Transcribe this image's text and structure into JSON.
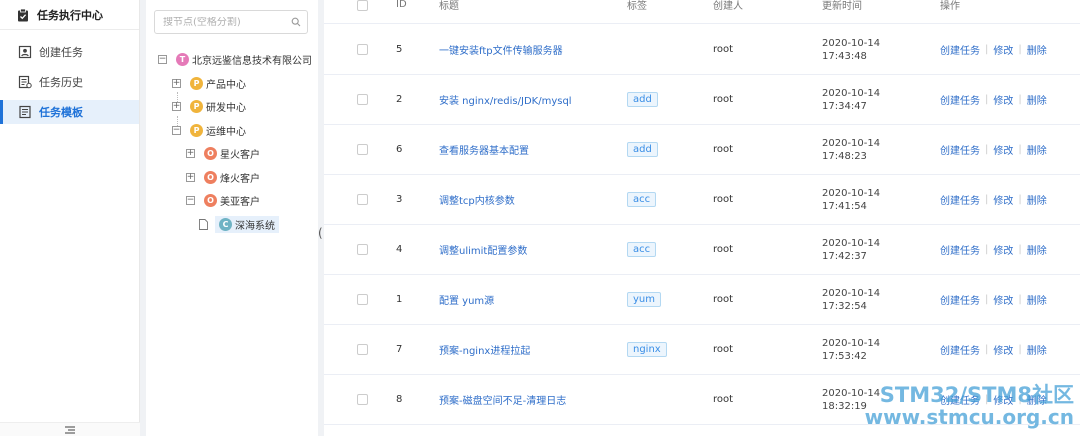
{
  "sidebar": {
    "header": "任务执行中心",
    "items": [
      {
        "label": "创建任务"
      },
      {
        "label": "任务历史"
      },
      {
        "label": "任务模板"
      }
    ]
  },
  "tree": {
    "search_placeholder": "搜节点(空格分割)",
    "root": {
      "badge": "T",
      "label": "北京远鉴信息技术有限公司"
    },
    "level1": [
      {
        "badge": "P",
        "label": "产品中心"
      },
      {
        "badge": "P",
        "label": "研发中心"
      },
      {
        "badge": "P",
        "label": "运维中心"
      }
    ],
    "level2": [
      {
        "badge": "O",
        "label": "星火客户"
      },
      {
        "badge": "O",
        "label": "烽火客户"
      },
      {
        "badge": "O",
        "label": "美亚客户"
      }
    ],
    "level3": {
      "badge": "C",
      "label": "深海系统"
    }
  },
  "table": {
    "columns": [
      "ID",
      "标题",
      "标签",
      "创建人",
      "更新时间",
      "操作"
    ],
    "rows": [
      {
        "id": "5",
        "title": "一键安装ftp文件传输服务器",
        "tag": "",
        "creator": "root",
        "date": "2020-10-14",
        "time": "17:43:48"
      },
      {
        "id": "2",
        "title": "安装 nginx/redis/JDK/mysql",
        "tag": "add",
        "creator": "root",
        "date": "2020-10-14",
        "time": "17:34:47"
      },
      {
        "id": "6",
        "title": "查看服务器基本配置",
        "tag": "add",
        "creator": "root",
        "date": "2020-10-14",
        "time": "17:48:23"
      },
      {
        "id": "3",
        "title": "调整tcp内核参数",
        "tag": "acc",
        "creator": "root",
        "date": "2020-10-14",
        "time": "17:41:54"
      },
      {
        "id": "4",
        "title": "调整ulimit配置参数",
        "tag": "acc",
        "creator": "root",
        "date": "2020-10-14",
        "time": "17:42:37"
      },
      {
        "id": "1",
        "title": "配置 yum源",
        "tag": "yum",
        "creator": "root",
        "date": "2020-10-14",
        "time": "17:32:54"
      },
      {
        "id": "7",
        "title": "预案-nginx进程拉起",
        "tag": "nginx",
        "creator": "root",
        "date": "2020-10-14",
        "time": "17:53:42"
      },
      {
        "id": "8",
        "title": "预案-磁盘空间不足-清理日志",
        "tag": "",
        "creator": "root",
        "date": "2020-10-14",
        "time": "18:32:19"
      }
    ],
    "actions": {
      "create": "创建任务",
      "edit": "修改",
      "delete": "删除"
    }
  },
  "watermark": {
    "line1": "STM32/STM8社区",
    "line2": "www.stmcu.org.cn"
  },
  "colors": {
    "accent": "#1f72d8",
    "link": "#2f6ec9",
    "tag_text": "#3a8ee6"
  }
}
